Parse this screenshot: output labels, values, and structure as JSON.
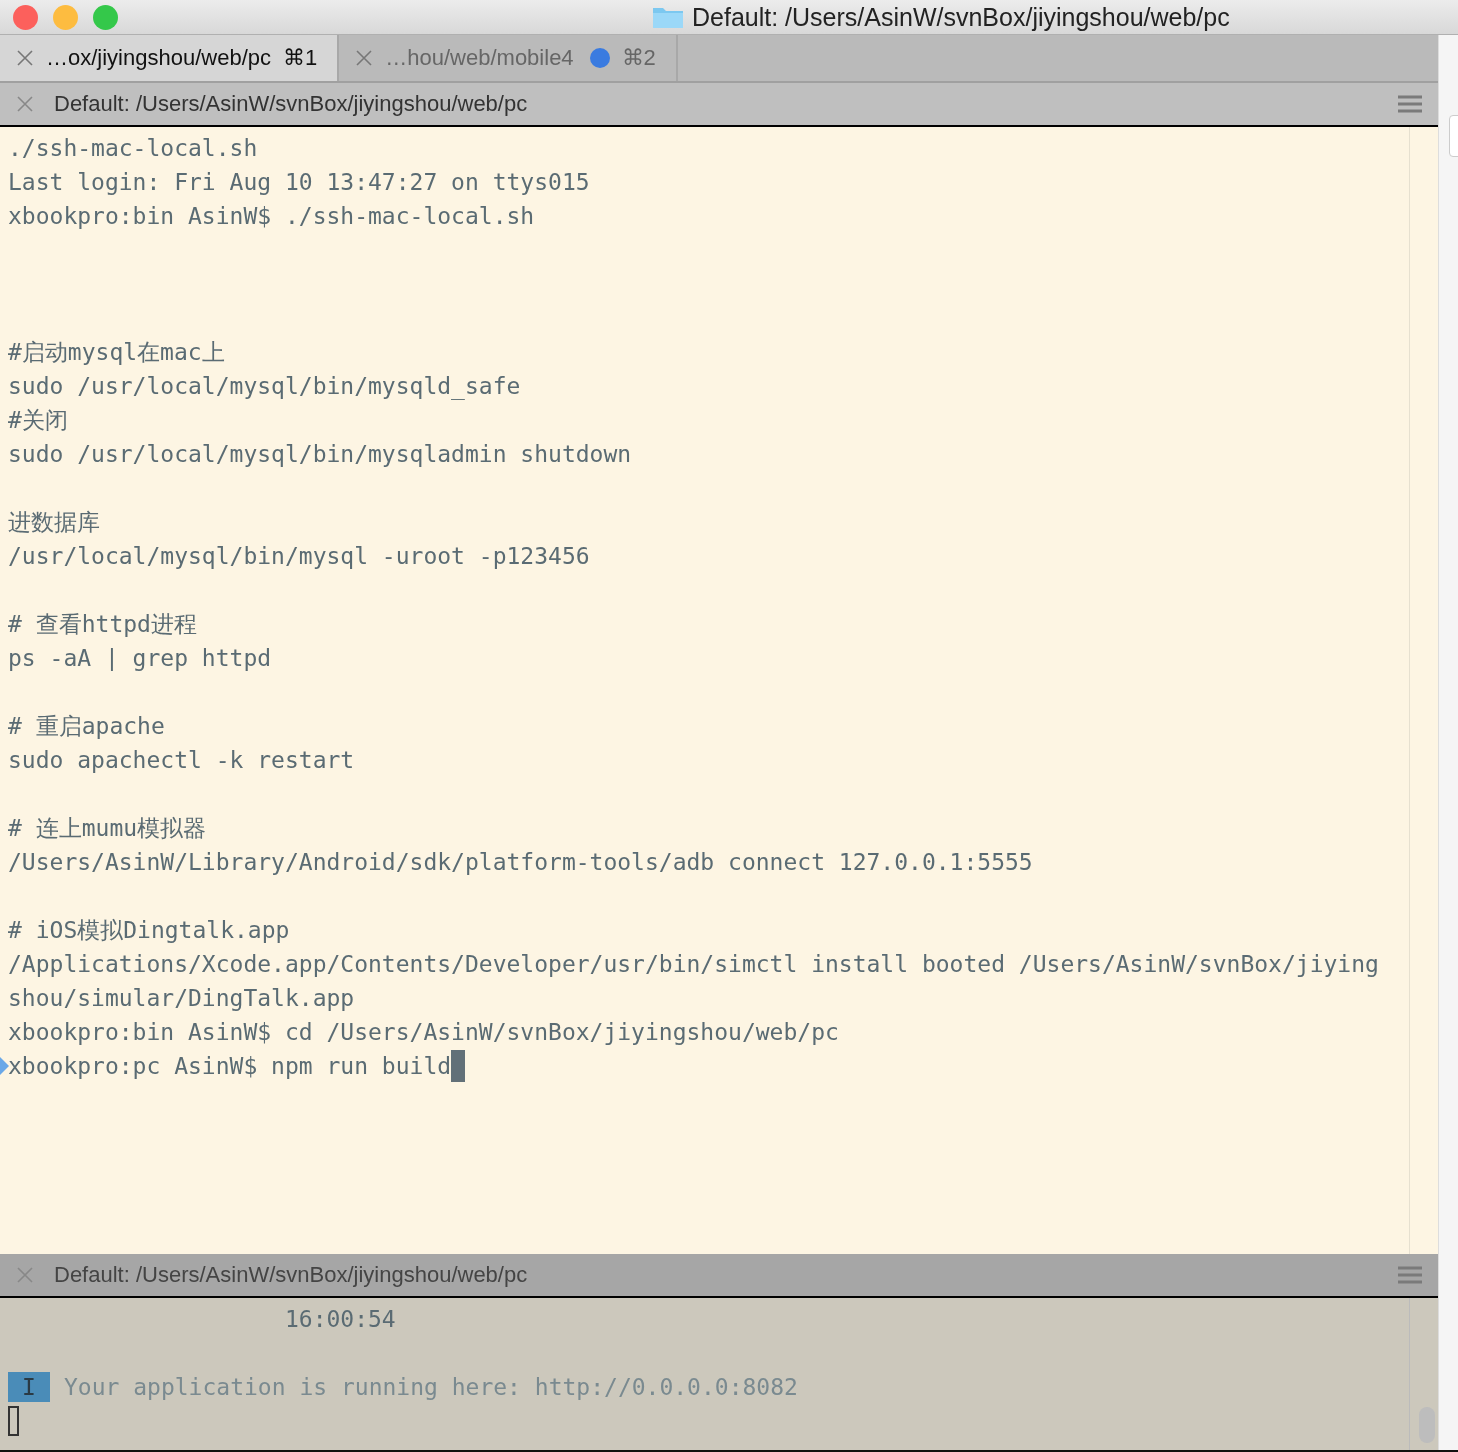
{
  "window": {
    "title": "Default: /Users/AsinW/svnBox/jiyingshou/web/pc"
  },
  "tabs": [
    {
      "label": "…ox/jiyingshou/web/pc",
      "shortcut": "⌘1",
      "selected": true,
      "activity": false
    },
    {
      "label": "…hou/web/mobile4",
      "shortcut": "⌘2",
      "selected": false,
      "activity": true
    }
  ],
  "panes": [
    {
      "title": "Default: /Users/AsinW/svnBox/jiyingshou/web/pc",
      "active": true,
      "lines": [
        {
          "kind": "text",
          "text": "./ssh-mac-local.sh"
        },
        {
          "kind": "text",
          "text": "Last login: Fri Aug 10 13:47:27 on ttys015"
        },
        {
          "kind": "text",
          "text": "xbookpro:bin AsinW$ ./ssh-mac-local.sh"
        },
        {
          "kind": "blank"
        },
        {
          "kind": "blank"
        },
        {
          "kind": "blank"
        },
        {
          "kind": "text",
          "text": "#启动mysql在mac上"
        },
        {
          "kind": "text",
          "text": "sudo /usr/local/mysql/bin/mysqld_safe"
        },
        {
          "kind": "text",
          "text": "#关闭"
        },
        {
          "kind": "text",
          "text": "sudo /usr/local/mysql/bin/mysqladmin shutdown"
        },
        {
          "kind": "blank"
        },
        {
          "kind": "text",
          "text": "进数据库"
        },
        {
          "kind": "text",
          "text": "/usr/local/mysql/bin/mysql -uroot -p123456"
        },
        {
          "kind": "blank"
        },
        {
          "kind": "text",
          "text": "# 查看httpd进程"
        },
        {
          "kind": "text",
          "text": "ps -aA | grep httpd"
        },
        {
          "kind": "blank"
        },
        {
          "kind": "text",
          "text": "# 重启apache"
        },
        {
          "kind": "text",
          "text": "sudo apachectl -k restart"
        },
        {
          "kind": "blank"
        },
        {
          "kind": "text",
          "text": "# 连上mumu模拟器"
        },
        {
          "kind": "text",
          "text": "/Users/AsinW/Library/Android/sdk/platform-tools/adb connect 127.0.0.1:5555"
        },
        {
          "kind": "blank"
        },
        {
          "kind": "text",
          "text": "# iOS模拟Dingtalk.app"
        },
        {
          "kind": "text",
          "text": "/Applications/Xcode.app/Contents/Developer/usr/bin/simctl install booted /Users/AsinW/svnBox/jiying"
        },
        {
          "kind": "text",
          "text": "shou/simular/DingTalk.app"
        },
        {
          "kind": "text",
          "text": "xbookpro:bin AsinW$ cd /Users/AsinW/svnBox/jiyingshou/web/pc"
        },
        {
          "kind": "prompt",
          "text": "xbookpro:pc AsinW$ npm run build"
        }
      ]
    },
    {
      "title": "Default: /Users/AsinW/svnBox/jiyingshou/web/pc",
      "active": false,
      "lines": [
        {
          "kind": "text",
          "text": "                    16:00:54"
        },
        {
          "kind": "blank"
        },
        {
          "kind": "badge",
          "badge": "I",
          "text": "Your application is running here: http://0.0.0.0:8082"
        },
        {
          "kind": "cursor"
        }
      ]
    }
  ]
}
